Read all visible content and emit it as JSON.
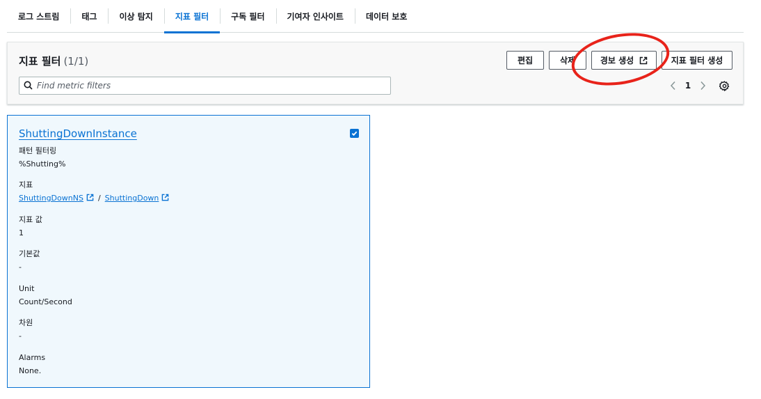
{
  "tabs": [
    {
      "label": "로그 스트림"
    },
    {
      "label": "태그"
    },
    {
      "label": "이상 탐지"
    },
    {
      "label": "지표 필터"
    },
    {
      "label": "구독 필터"
    },
    {
      "label": "기여자 인사이트"
    },
    {
      "label": "데이터 보호"
    }
  ],
  "active_tab": "지표 필터",
  "panel": {
    "title": "지표 필터",
    "count": "(1/1)",
    "buttons": {
      "edit": "편집",
      "delete": "삭제",
      "create_alarm": "경보 생성",
      "create_filter": "지표 필터 생성"
    },
    "search_placeholder": "Find metric filters",
    "pagination": {
      "current_page": "1"
    }
  },
  "card": {
    "title": "ShuttingDownInstance",
    "selected": true,
    "fields": {
      "pattern_label": "패턴 필터링",
      "pattern_value": "%Shutting%",
      "metric_label": "지표",
      "metric_namespace": "ShuttingDownNS",
      "metric_separator": "/",
      "metric_name": "ShuttingDown",
      "metric_value_label": "지표 값",
      "metric_value": "1",
      "default_label": "기본값",
      "default_value": "-",
      "unit_label": "Unit",
      "unit_value": "Count/Second",
      "dimensions_label": "차원",
      "dimensions_value": "-",
      "alarms_label": "Alarms",
      "alarms_value": "None."
    }
  },
  "colors": {
    "accent": "#0972d3",
    "annotation": "#e8231a",
    "card_bg": "#f0f8fd"
  }
}
